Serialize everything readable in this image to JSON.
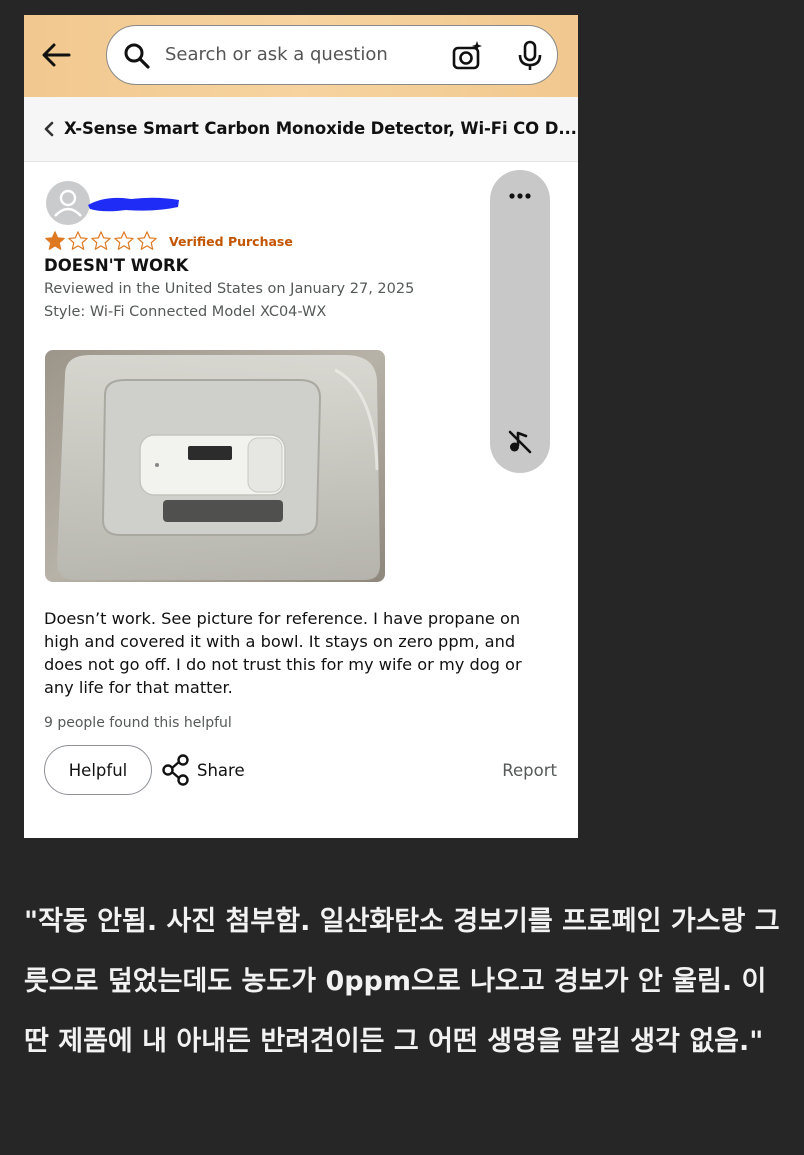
{
  "search": {
    "placeholder": "Search or ask a question"
  },
  "icons": {
    "back": "arrow-left-icon",
    "search": "search-icon",
    "camera": "camera-sparkle-icon",
    "mic": "microphone-icon",
    "chevron": "chevron-left-icon",
    "avatar": "user-avatar-icon",
    "share": "share-icon",
    "more": "more-dots-icon",
    "mute": "mute-icon"
  },
  "colors": {
    "topbar": "#f3cb93",
    "star_filled": "#de7921",
    "verified": "#c45500",
    "caption_bg": "#262626"
  },
  "product": {
    "breadcrumb_title": "X-Sense Smart Carbon Monoxide Detector, Wi-Fi CO D..."
  },
  "review": {
    "rating": 1,
    "rating_max": 5,
    "verified_label": "Verified Purchase",
    "title": "DOESN'T WORK",
    "date_line": "Reviewed in the United States on January 27, 2025",
    "style_line": "Style: Wi-Fi Connected Model XC04-WX",
    "body": "Doesn’t work. See picture for reference. I have propane on high and covered it with a bowl. It stays on zero ppm, and does not go off. I do not trust this for my wife or my dog or any life for that matter.",
    "helpful_count_text": "9 people found this helpful",
    "helpful_button": "Helpful",
    "share_label": "Share",
    "report_label": "Report"
  },
  "caption": "\"작동 안됨. 사진 첨부함. 일산화탄소 경보기를 프로페인 가스랑 그릇으로 덮었는데도 농도가 0ppm으로 나오고 경보가 안 울림. 이딴 제품에 내 아내든 반려견이든 그 어떤 생명을 맡길 생각 없음.\""
}
